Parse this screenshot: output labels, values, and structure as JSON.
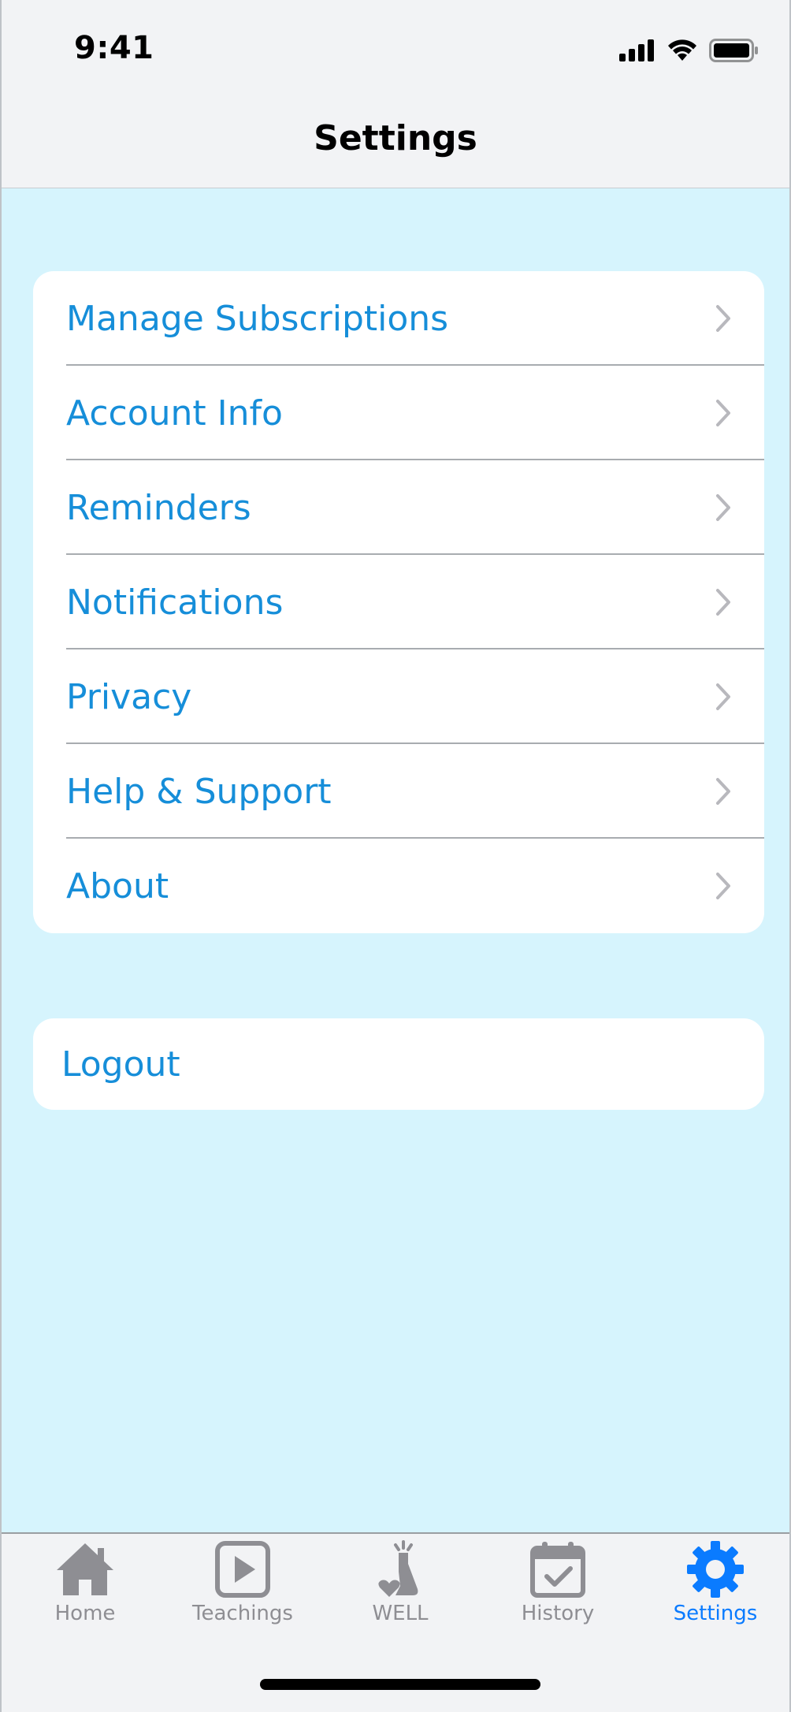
{
  "status_bar": {
    "time": "9:41"
  },
  "nav": {
    "title": "Settings"
  },
  "menu": {
    "items": [
      {
        "label": "Manage Subscriptions"
      },
      {
        "label": "Account Info"
      },
      {
        "label": "Reminders"
      },
      {
        "label": "Notifications"
      },
      {
        "label": "Privacy"
      },
      {
        "label": "Help & Support"
      },
      {
        "label": "About"
      }
    ]
  },
  "logout": {
    "label": "Logout"
  },
  "tabs": [
    {
      "label": "Home",
      "icon": "house-icon"
    },
    {
      "label": "Teachings",
      "icon": "play-square-icon"
    },
    {
      "label": "WELL",
      "icon": "well-flask-icon"
    },
    {
      "label": "History",
      "icon": "calendar-check-icon"
    },
    {
      "label": "Settings",
      "icon": "gear-icon",
      "active": true
    }
  ],
  "colors": {
    "background": "#d6f4fd",
    "link_text": "#168ed9",
    "tab_active": "#0a7bff",
    "tab_inactive": "#8e8e93"
  }
}
